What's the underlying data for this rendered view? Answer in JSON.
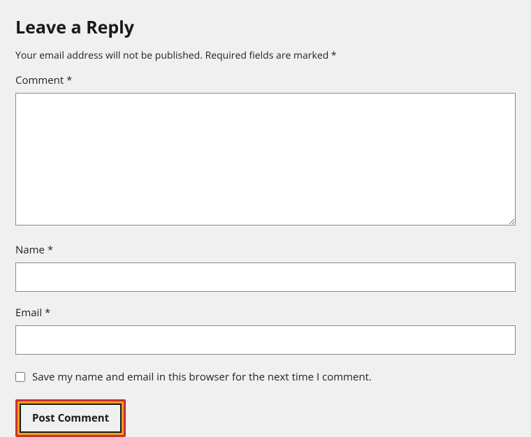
{
  "heading": "Leave a Reply",
  "notice_part1": "Your email address will not be published.",
  "notice_part2": "Required fields are marked *",
  "labels": {
    "comment": "Comment *",
    "name": "Name *",
    "email": "Email *",
    "saveInfo": "Save my name and email in this browser for the next time I comment."
  },
  "values": {
    "comment": "",
    "name": "",
    "email": "",
    "saveInfoChecked": false
  },
  "button": {
    "submit": "Post Comment"
  }
}
